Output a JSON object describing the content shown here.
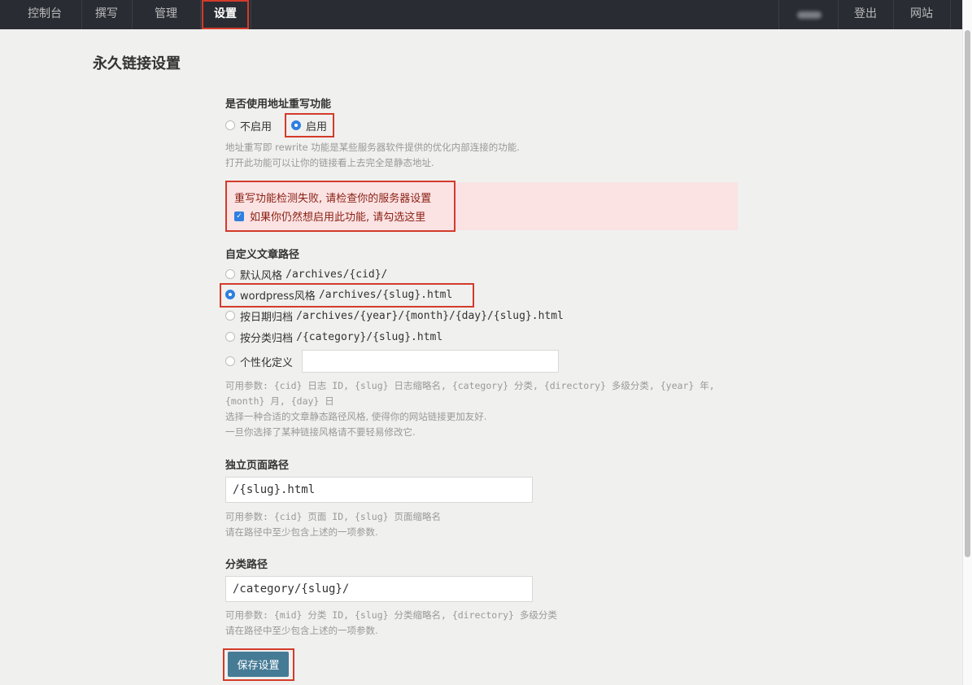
{
  "nav": {
    "items": [
      {
        "label": "控制台"
      },
      {
        "label": "撰写"
      },
      {
        "label": "管理"
      },
      {
        "label": "设置"
      }
    ],
    "right": [
      {
        "label": "登出"
      },
      {
        "label": "网站"
      }
    ]
  },
  "page": {
    "title": "永久链接设置"
  },
  "rewrite": {
    "label": "是否使用地址重写功能",
    "options": [
      {
        "label": "不启用",
        "selected": false
      },
      {
        "label": "启用",
        "selected": true
      }
    ],
    "desc1": "地址重写即 rewrite 功能是某些服务器软件提供的优化内部连接的功能.",
    "desc2": "打开此功能可以让你的链接看上去完全是静态地址.",
    "warning": "重写功能检测失败, 请检查你的服务器设置",
    "force_label": "如果你仍然想启用此功能, 请勾选这里",
    "force_checked": true
  },
  "post_path": {
    "label": "自定义文章路径",
    "options": [
      {
        "label": "默认风格",
        "pattern": "/archives/{cid}/",
        "selected": false
      },
      {
        "label": "wordpress风格",
        "pattern": "/archives/{slug}.html",
        "selected": true
      },
      {
        "label": "按日期归档",
        "pattern": "/archives/{year}/{month}/{day}/{slug}.html",
        "selected": false
      },
      {
        "label": "按分类归档",
        "pattern": "/{category}/{slug}.html",
        "selected": false
      },
      {
        "label": "个性化定义",
        "pattern": "",
        "selected": false
      }
    ],
    "custom_value": "",
    "params_line1": "可用参数: {cid} 日志 ID, {slug} 日志缩略名, {category} 分类, {directory} 多级分类, {year} 年,",
    "params_line2": "{month} 月, {day} 日",
    "desc1": "选择一种合适的文章静态路径风格, 使得你的网站链接更加友好.",
    "desc2": "一旦你选择了某种链接风格请不要轻易修改它."
  },
  "page_path": {
    "label": "独立页面路径",
    "value": "/{slug}.html",
    "params": "可用参数: {cid} 页面 ID, {slug} 页面缩略名",
    "desc": "请在路径中至少包含上述的一项参数."
  },
  "category_path": {
    "label": "分类路径",
    "value": "/category/{slug}/",
    "params": "可用参数: {mid} 分类 ID, {slug} 分类缩略名, {directory} 多级分类",
    "desc": "请在路径中至少包含上述的一项参数."
  },
  "save_button": "保存设置",
  "colors": {
    "topbar": "#292d33",
    "accent_button": "#467b96",
    "radio_selected": "#2f7fe0",
    "warning_bg": "#fbe3e4",
    "highlight": "#d33b2a"
  }
}
